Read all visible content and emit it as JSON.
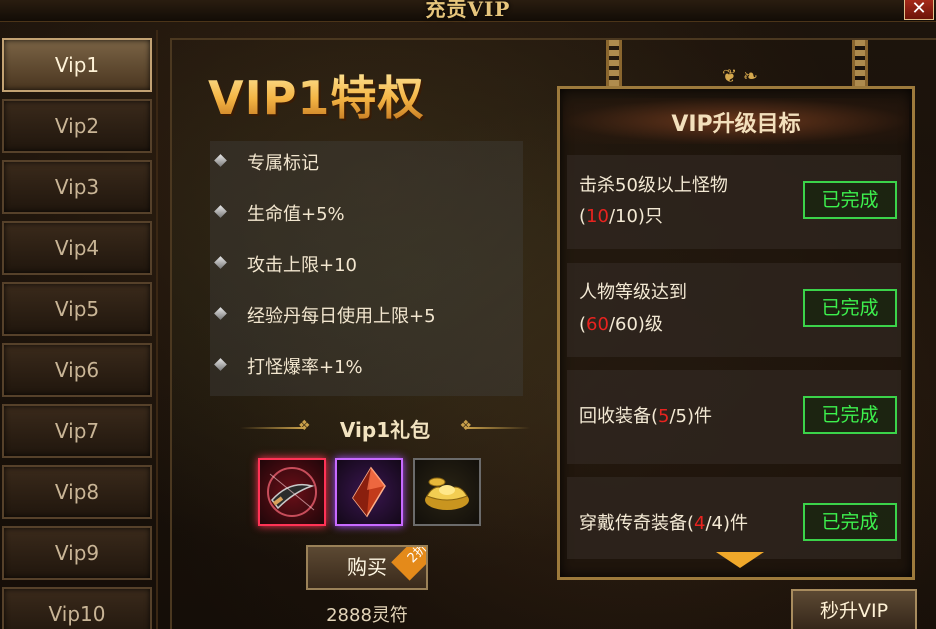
{
  "window": {
    "title": "充贡VIP",
    "close_glyph": "✕"
  },
  "sidebar": {
    "tabs": [
      {
        "label": "Vip1",
        "active": true
      },
      {
        "label": "Vip2",
        "active": false
      },
      {
        "label": "Vip3",
        "active": false
      },
      {
        "label": "Vip4",
        "active": false
      },
      {
        "label": "Vip5",
        "active": false
      },
      {
        "label": "Vip6",
        "active": false
      },
      {
        "label": "Vip7",
        "active": false
      },
      {
        "label": "Vip8",
        "active": false
      },
      {
        "label": "Vip9",
        "active": false
      },
      {
        "label": "Vip10",
        "active": false
      }
    ]
  },
  "privileges": {
    "title": "VIP1特权",
    "items": [
      "专属标记",
      "生命值+5%",
      "攻击上限+10",
      "经验丹每日使用上限+5",
      "打怪爆率+1%"
    ]
  },
  "gift": {
    "title": "Vip1礼包",
    "items": [
      {
        "icon": "red-blade-item-icon",
        "rarity": "red"
      },
      {
        "icon": "purple-gem-item-icon",
        "rarity": "purple"
      },
      {
        "icon": "gold-ingot-item-icon",
        "rarity": "gold"
      }
    ],
    "buy_label": "购买",
    "discount": "2折",
    "price": "2888灵符"
  },
  "goals": {
    "title": "VIP升级目标",
    "rows": [
      {
        "line1": "击杀50级以上怪物",
        "line2_prefix": "(",
        "current": "10",
        "line2_suffix": "/10)只",
        "status": "已完成"
      },
      {
        "line1": "人物等级达到",
        "line2_prefix": "(",
        "current": "60",
        "line2_suffix": "/60)级",
        "status": "已完成"
      },
      {
        "line1": "",
        "line2_prefix": "回收装备(",
        "current": "5",
        "line2_suffix": "/5)件",
        "status": "已完成"
      },
      {
        "line1": "",
        "line2_prefix": "穿戴传奇装备(",
        "current": "4",
        "line2_suffix": "/4)件",
        "status": "已完成"
      }
    ]
  },
  "upgrade_button": "秒升VIP",
  "colors": {
    "accent_gold": "#f0b24a",
    "done_green": "#3df04d",
    "progress_red": "#e8231f"
  }
}
